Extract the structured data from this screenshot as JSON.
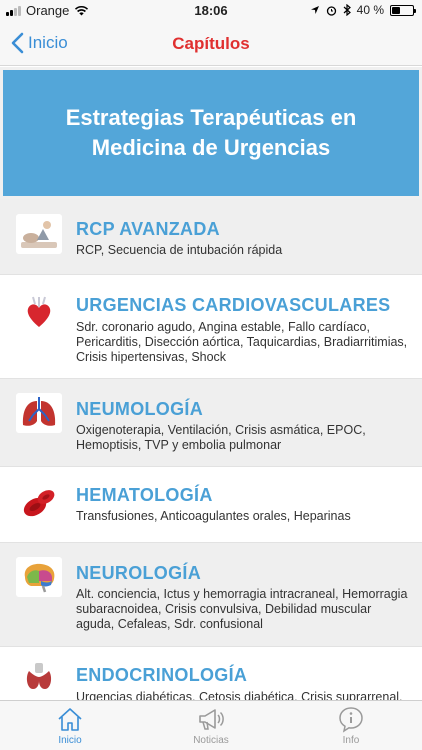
{
  "status_bar": {
    "carrier": "Orange",
    "time": "18:06",
    "battery": "40 %",
    "battery_level": 0.4
  },
  "nav": {
    "back_label": "Inicio",
    "title": "Capítulos"
  },
  "banner": {
    "title": "Estrategias Terapéuticas en Medicina de Urgencias"
  },
  "chapters": [
    {
      "title": "RCP AVANZADA",
      "subtitle": "RCP, Secuencia de intubación rápida",
      "icon": "cpr-icon"
    },
    {
      "title": "URGENCIAS CARDIOVASCULARES",
      "subtitle": "Sdr. coronario agudo, Angina estable, Fallo cardíaco, Pericarditis, Disección aórtica, Taquicardias, Bradiarritimias, Crisis hipertensivas, Shock",
      "icon": "heart-icon"
    },
    {
      "title": "NEUMOLOGÍA",
      "subtitle": "Oxigenoterapia, Ventilación, Crisis asmática, EPOC, Hemoptisis, TVP y embolia pulmonar",
      "icon": "lungs-icon"
    },
    {
      "title": "HEMATOLOGÍA",
      "subtitle": "Transfusiones, Anticoagulantes orales, Heparinas",
      "icon": "blood-cells-icon"
    },
    {
      "title": "NEUROLOGÍA",
      "subtitle": "Alt. conciencia, Ictus y hemorragia intracraneal, Hemorragia subaracnoidea, Crisis convulsiva, Debilidad muscular aguda, Cefaleas, Sdr. confusional",
      "icon": "brain-icon"
    },
    {
      "title": "ENDOCRINOLOGÍA",
      "subtitle": "Urgencias diabéticas, Cetosis diabética, Crisis suprarrenal,",
      "icon": "thyroid-icon"
    }
  ],
  "tabs": [
    {
      "label": "Inicio",
      "icon": "home-icon",
      "active": true
    },
    {
      "label": "Noticias",
      "icon": "megaphone-icon",
      "active": false
    },
    {
      "label": "Info",
      "icon": "info-icon",
      "active": false
    }
  ],
  "colors": {
    "accent": "#3a8ed6",
    "title_red": "#e03030",
    "banner_blue": "#53a6d9",
    "chapter_title_blue": "#4aa0d6"
  }
}
